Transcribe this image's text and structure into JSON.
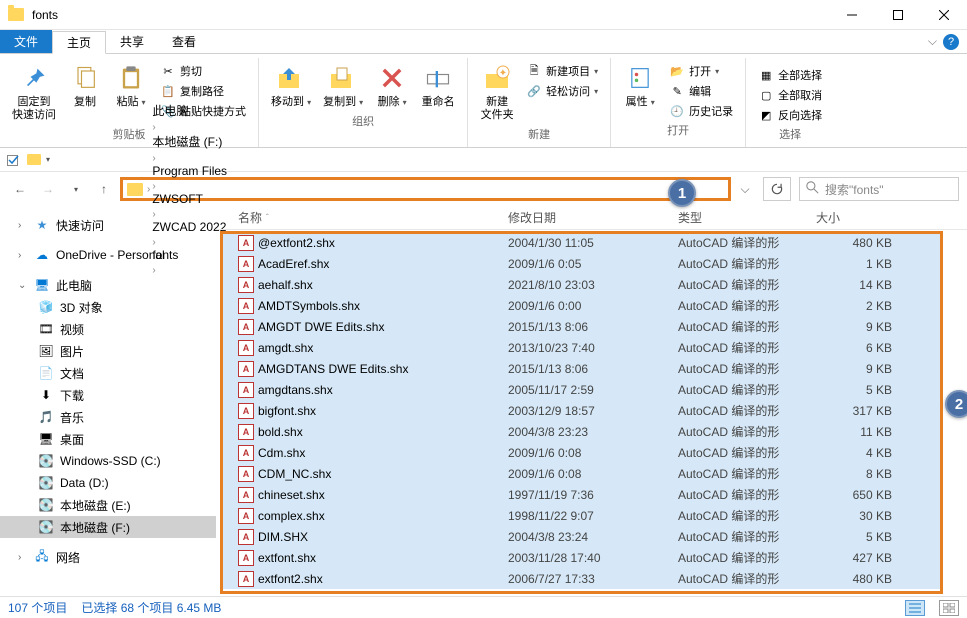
{
  "window": {
    "title": "fonts"
  },
  "tabs": {
    "file": "文件",
    "home": "主页",
    "share": "共享",
    "view": "查看"
  },
  "ribbon": {
    "clipboard": {
      "pin": "固定到\n快速访问",
      "copy": "复制",
      "paste": "粘贴",
      "cut": "剪切",
      "copypath": "复制路径",
      "pasteshortcut": "粘贴快捷方式",
      "group": "剪贴板"
    },
    "organize": {
      "moveto": "移动到",
      "copyto": "复制到",
      "delete": "删除",
      "rename": "重命名",
      "group": "组织"
    },
    "new": {
      "newfolder": "新建\n文件夹",
      "newitem": "新建项目",
      "easyaccess": "轻松访问",
      "group": "新建"
    },
    "open": {
      "properties": "属性",
      "open": "打开",
      "edit": "编辑",
      "history": "历史记录",
      "group": "打开"
    },
    "select": {
      "selectall": "全部选择",
      "selectnone": "全部取消",
      "invert": "反向选择",
      "group": "选择"
    }
  },
  "breadcrumb": [
    "此电脑",
    "本地磁盘 (F:)",
    "Program Files",
    "ZWSOFT",
    "ZWCAD 2022",
    "fonts"
  ],
  "search": {
    "placeholder": "搜索\"fonts\""
  },
  "callouts": {
    "one": "1",
    "two": "2"
  },
  "nav": {
    "quickaccess": "快速访问",
    "onedrive": "OneDrive - Personal",
    "thispc": "此电脑",
    "threed": "3D 对象",
    "videos": "视频",
    "pictures": "图片",
    "documents": "文档",
    "downloads": "下载",
    "music": "音乐",
    "desktop": "桌面",
    "ssd_c": "Windows-SSD (C:)",
    "data_d": "Data (D:)",
    "disk_e": "本地磁盘 (E:)",
    "disk_f": "本地磁盘 (F:)",
    "network": "网络"
  },
  "columns": {
    "name": "名称",
    "date": "修改日期",
    "type": "类型",
    "size": "大小"
  },
  "file_type": "AutoCAD 编译的形",
  "files": [
    {
      "name": "@extfont2.shx",
      "date": "2004/1/30 11:05",
      "size": "480 KB"
    },
    {
      "name": "AcadEref.shx",
      "date": "2009/1/6 0:05",
      "size": "1 KB"
    },
    {
      "name": "aehalf.shx",
      "date": "2021/8/10 23:03",
      "size": "14 KB"
    },
    {
      "name": "AMDTSymbols.shx",
      "date": "2009/1/6 0:00",
      "size": "2 KB"
    },
    {
      "name": "AMGDT DWE Edits.shx",
      "date": "2015/1/13 8:06",
      "size": "9 KB"
    },
    {
      "name": "amgdt.shx",
      "date": "2013/10/23 7:40",
      "size": "6 KB"
    },
    {
      "name": "AMGDTANS DWE Edits.shx",
      "date": "2015/1/13 8:06",
      "size": "9 KB"
    },
    {
      "name": "amgdtans.shx",
      "date": "2005/11/17 2:59",
      "size": "5 KB"
    },
    {
      "name": "bigfont.shx",
      "date": "2003/12/9 18:57",
      "size": "317 KB"
    },
    {
      "name": "bold.shx",
      "date": "2004/3/8 23:23",
      "size": "11 KB"
    },
    {
      "name": "Cdm.shx",
      "date": "2009/1/6 0:08",
      "size": "4 KB"
    },
    {
      "name": "CDM_NC.shx",
      "date": "2009/1/6 0:08",
      "size": "8 KB"
    },
    {
      "name": "chineset.shx",
      "date": "1997/11/19 7:36",
      "size": "650 KB"
    },
    {
      "name": "complex.shx",
      "date": "1998/11/22 9:07",
      "size": "30 KB"
    },
    {
      "name": "DIM.SHX",
      "date": "2004/3/8 23:24",
      "size": "5 KB"
    },
    {
      "name": "extfont.shx",
      "date": "2003/11/28 17:40",
      "size": "427 KB"
    },
    {
      "name": "extfont2.shx",
      "date": "2006/7/27 17:33",
      "size": "480 KB"
    }
  ],
  "status": {
    "items": "107 个项目",
    "selected": "已选择 68 个项目  6.45 MB"
  }
}
